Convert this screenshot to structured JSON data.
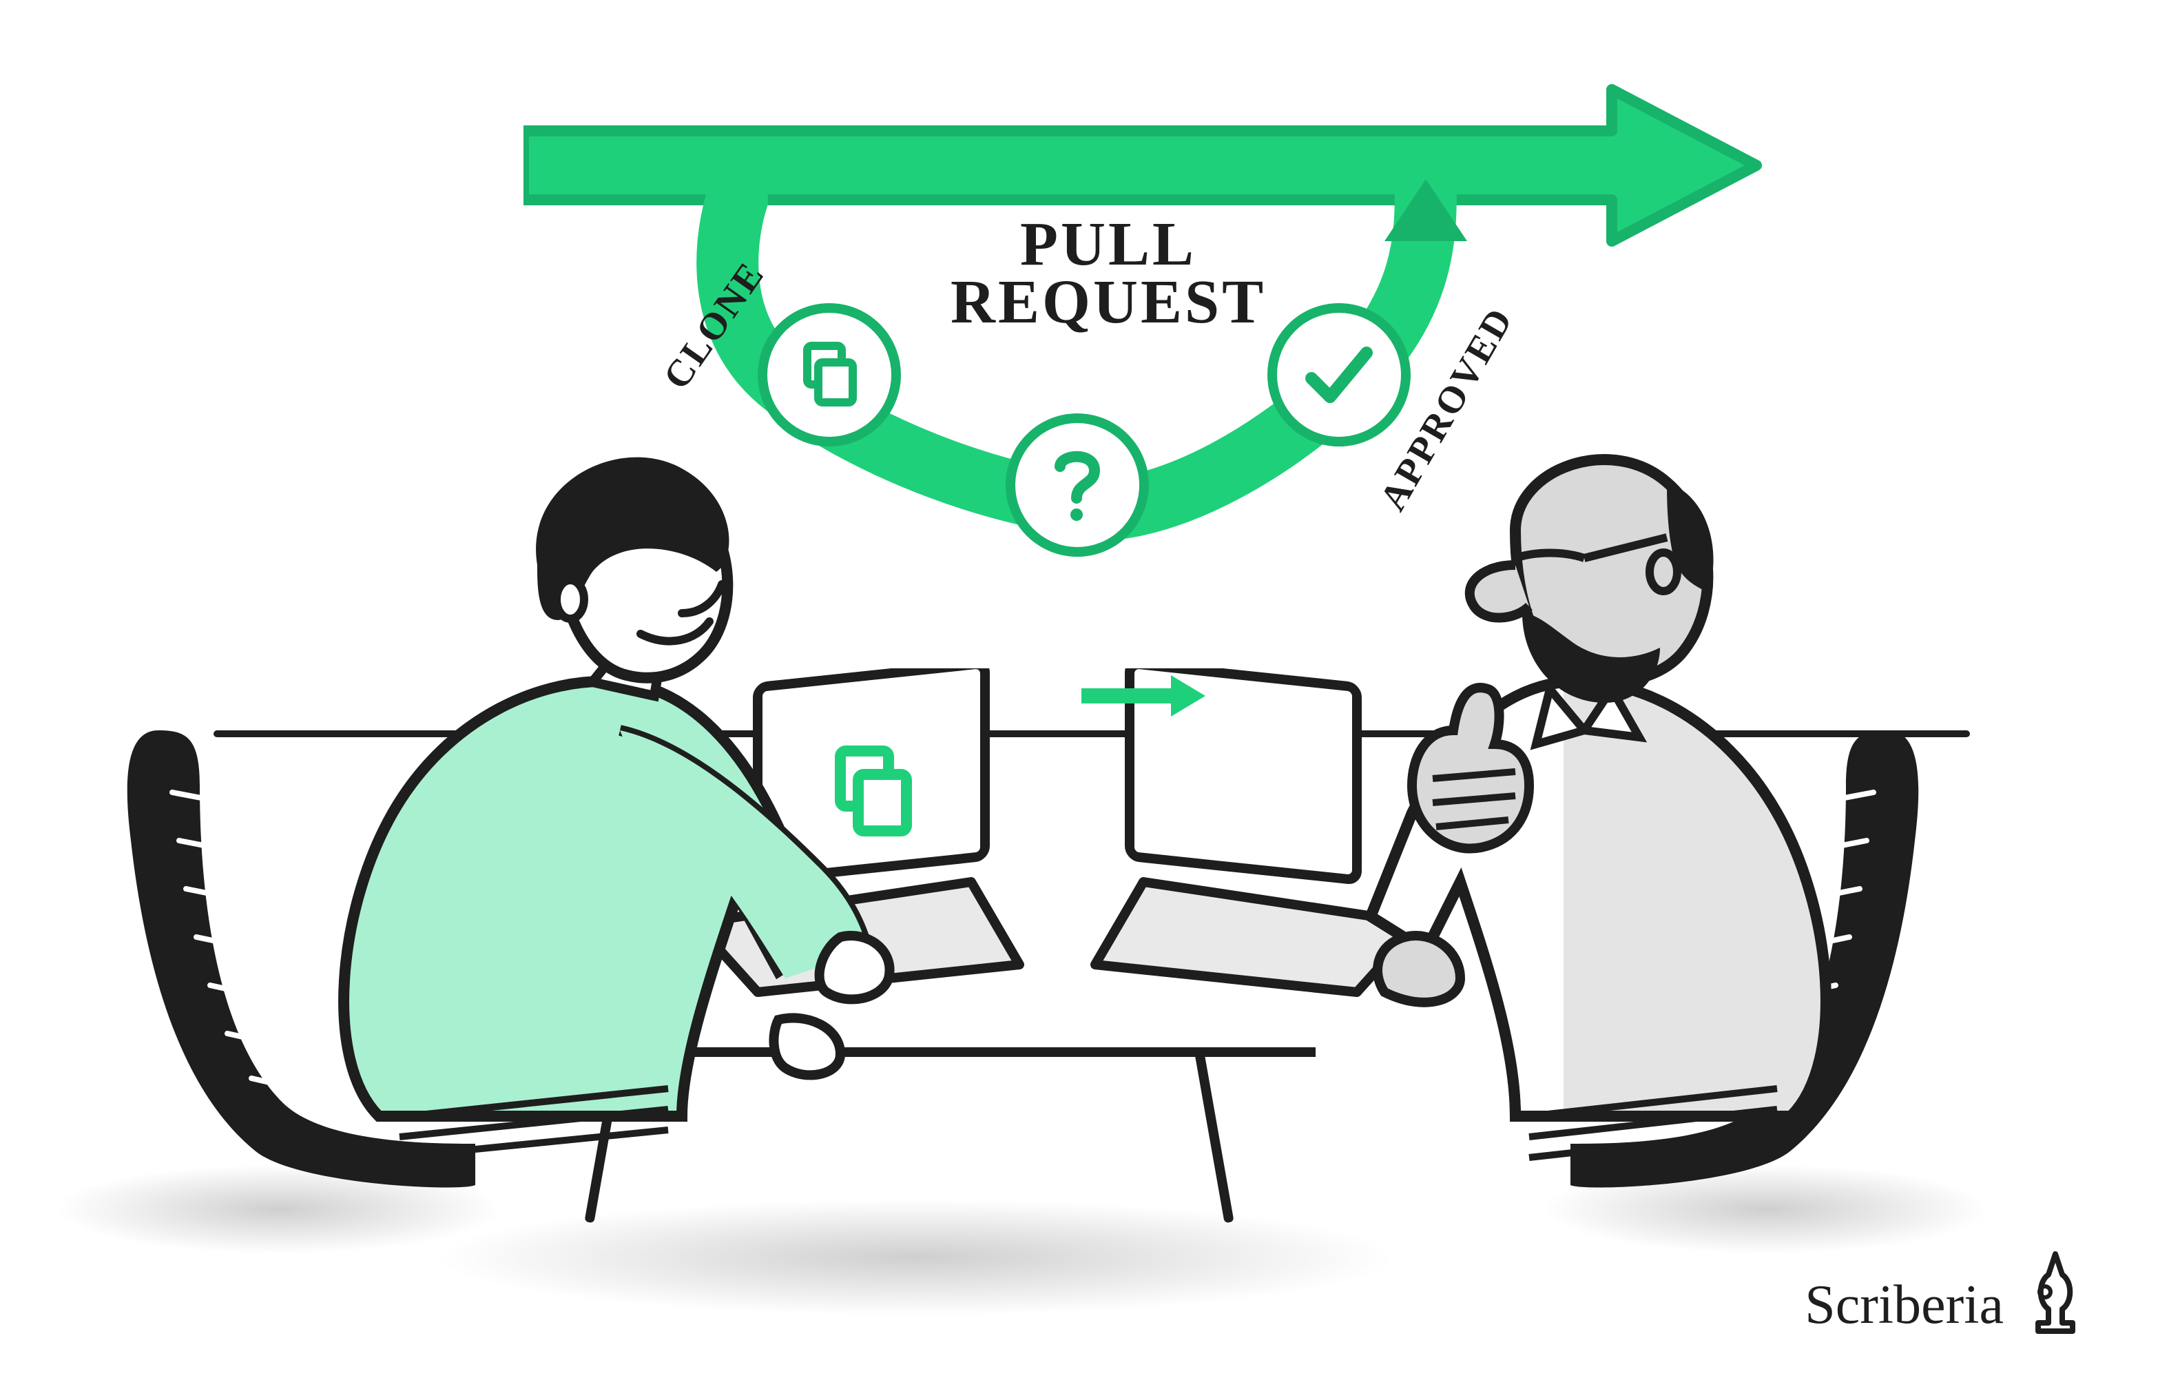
{
  "diagram": {
    "title_line1": "PULL",
    "title_line2": "REQUEST",
    "steps": [
      {
        "id": "clone",
        "label": "CLONE",
        "icon": "copy-icon"
      },
      {
        "id": "review",
        "label": "",
        "icon": "question-icon"
      },
      {
        "id": "approved",
        "label": "APPROVED",
        "icon": "check-icon"
      }
    ],
    "flow_direction": "left-to-right",
    "branch_rejoins_main": true
  },
  "scene": {
    "people": [
      {
        "id": "contributor",
        "side": "left",
        "shirt_color": "#a9f0d1",
        "gesture": "typing",
        "laptop_icon": "copy-icon"
      },
      {
        "id": "reviewer",
        "side": "right",
        "shirt_color": "#ffffff",
        "gesture": "thumbs-up",
        "laptop_icon": "arrow-right-icon"
      }
    ]
  },
  "colors": {
    "accent": "#1fd07a",
    "accent_dark": "#18b36a",
    "ink": "#1e1e1e",
    "shade": "#cfcfcf",
    "mint": "#a9f0d1"
  },
  "attribution": "Scriberia"
}
